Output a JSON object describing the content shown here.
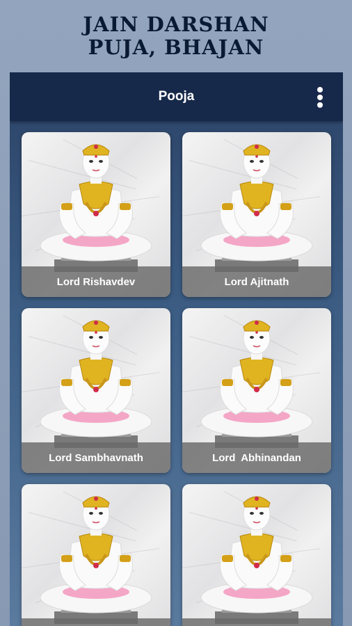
{
  "banner": {
    "line1": "JAIN DARSHAN",
    "line2": "PUJA, BHAJAN"
  },
  "appbar": {
    "title": "Pooja",
    "menu_icon": "more-vert-icon"
  },
  "cards": [
    {
      "label": "Lord Rishavdev"
    },
    {
      "label": "Lord Ajitnath"
    },
    {
      "label": "Lord Sambhavnath"
    },
    {
      "label": "Lord  Abhinandan"
    },
    {
      "label": ""
    },
    {
      "label": ""
    }
  ],
  "colors": {
    "appbar": "#17294a",
    "caption_overlay": "#696969",
    "gold": "#d4a017",
    "pink": "#f2a9c8"
  }
}
